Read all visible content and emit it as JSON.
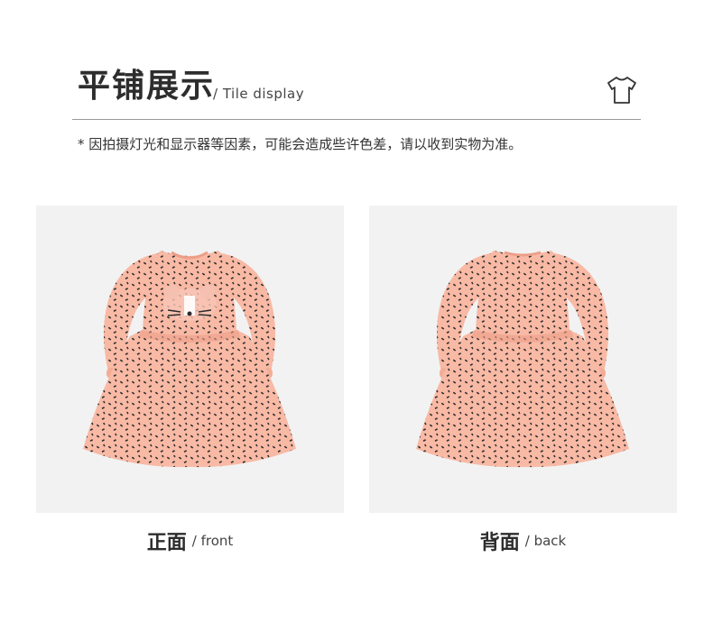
{
  "header": {
    "title": "平铺展示",
    "subtitle": "/ Tile display",
    "icon": "tshirt-icon"
  },
  "disclaimer": "* 因拍摄灯光和显示器等因素，可能会造成些许色差，请以收到实物为准。",
  "panels": [
    {
      "label_zh": "正面",
      "label_en": "/ front"
    },
    {
      "label_zh": "背面",
      "label_en": "/ back"
    }
  ],
  "colors": {
    "dress_pink": "#f8b9a5",
    "dress_shadow": "#ec9f88",
    "dots": "#2b2b2b",
    "panel_bg": "#f2f2f2"
  }
}
